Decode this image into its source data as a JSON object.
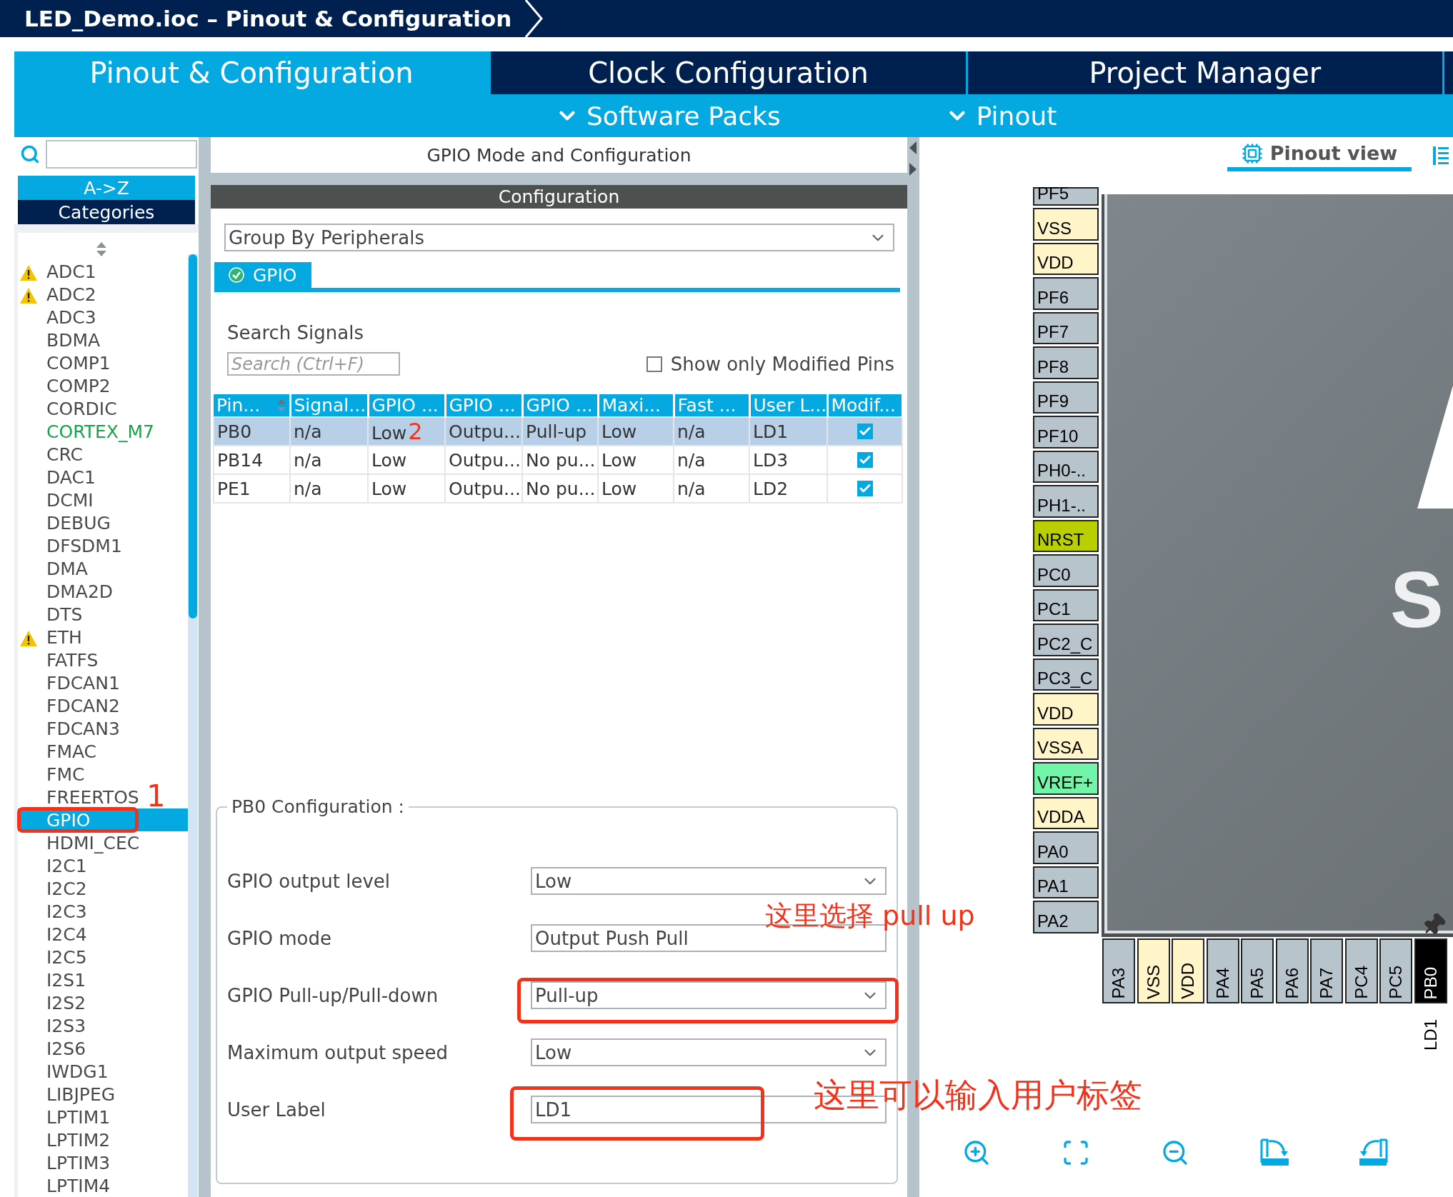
{
  "window": {
    "title": "LED_Demo.ioc – Pinout & Configuration"
  },
  "tabs": [
    {
      "label": "Pinout & Configuration",
      "selected": true
    },
    {
      "label": "Clock Configuration",
      "selected": false
    },
    {
      "label": "Project Manager",
      "selected": false
    }
  ],
  "menus": [
    {
      "label": "Software Packs"
    },
    {
      "label": "Pinout"
    }
  ],
  "sidebar": {
    "sort_modes": [
      {
        "label": "A->Z",
        "selected": true
      },
      {
        "label": "Categories",
        "selected": false
      }
    ],
    "items": [
      {
        "label": "ADC1",
        "warning": true,
        "configured": false,
        "selected": false
      },
      {
        "label": "ADC2",
        "warning": true,
        "configured": false,
        "selected": false
      },
      {
        "label": "ADC3",
        "warning": false,
        "configured": false,
        "selected": false
      },
      {
        "label": "BDMA",
        "warning": false,
        "configured": false,
        "selected": false
      },
      {
        "label": "COMP1",
        "warning": false,
        "configured": false,
        "selected": false
      },
      {
        "label": "COMP2",
        "warning": false,
        "configured": false,
        "selected": false
      },
      {
        "label": "CORDIC",
        "warning": false,
        "configured": false,
        "selected": false
      },
      {
        "label": "CORTEX_M7",
        "warning": false,
        "configured": true,
        "selected": false
      },
      {
        "label": "CRC",
        "warning": false,
        "configured": false,
        "selected": false
      },
      {
        "label": "DAC1",
        "warning": false,
        "configured": false,
        "selected": false
      },
      {
        "label": "DCMI",
        "warning": false,
        "configured": false,
        "selected": false
      },
      {
        "label": "DEBUG",
        "warning": false,
        "configured": false,
        "selected": false
      },
      {
        "label": "DFSDM1",
        "warning": false,
        "configured": false,
        "selected": false
      },
      {
        "label": "DMA",
        "warning": false,
        "configured": false,
        "selected": false
      },
      {
        "label": "DMA2D",
        "warning": false,
        "configured": false,
        "selected": false
      },
      {
        "label": "DTS",
        "warning": false,
        "configured": false,
        "selected": false
      },
      {
        "label": "ETH",
        "warning": true,
        "configured": false,
        "selected": false
      },
      {
        "label": "FATFS",
        "warning": false,
        "configured": false,
        "selected": false
      },
      {
        "label": "FDCAN1",
        "warning": false,
        "configured": false,
        "selected": false
      },
      {
        "label": "FDCAN2",
        "warning": false,
        "configured": false,
        "selected": false
      },
      {
        "label": "FDCAN3",
        "warning": false,
        "configured": false,
        "selected": false
      },
      {
        "label": "FMAC",
        "warning": false,
        "configured": false,
        "selected": false
      },
      {
        "label": "FMC",
        "warning": false,
        "configured": false,
        "selected": false
      },
      {
        "label": "FREERTOS",
        "warning": false,
        "configured": false,
        "selected": false
      },
      {
        "label": "GPIO",
        "warning": false,
        "configured": false,
        "selected": true
      },
      {
        "label": "HDMI_CEC",
        "warning": false,
        "configured": false,
        "selected": false
      },
      {
        "label": "I2C1",
        "warning": false,
        "configured": false,
        "selected": false
      },
      {
        "label": "I2C2",
        "warning": false,
        "configured": false,
        "selected": false
      },
      {
        "label": "I2C3",
        "warning": false,
        "configured": false,
        "selected": false
      },
      {
        "label": "I2C4",
        "warning": false,
        "configured": false,
        "selected": false
      },
      {
        "label": "I2C5",
        "warning": false,
        "configured": false,
        "selected": false
      },
      {
        "label": "I2S1",
        "warning": false,
        "configured": false,
        "selected": false
      },
      {
        "label": "I2S2",
        "warning": false,
        "configured": false,
        "selected": false
      },
      {
        "label": "I2S3",
        "warning": false,
        "configured": false,
        "selected": false
      },
      {
        "label": "I2S6",
        "warning": false,
        "configured": false,
        "selected": false
      },
      {
        "label": "IWDG1",
        "warning": false,
        "configured": false,
        "selected": false
      },
      {
        "label": "LIBJPEG",
        "warning": false,
        "configured": false,
        "selected": false
      },
      {
        "label": "LPTIM1",
        "warning": false,
        "configured": false,
        "selected": false
      },
      {
        "label": "LPTIM2",
        "warning": false,
        "configured": false,
        "selected": false
      },
      {
        "label": "LPTIM3",
        "warning": false,
        "configured": false,
        "selected": false
      },
      {
        "label": "LPTIM4",
        "warning": false,
        "configured": false,
        "selected": false
      }
    ]
  },
  "mode_panel": {
    "title": "GPIO Mode and Configuration",
    "section": "Configuration",
    "group_by": "Group By Peripherals",
    "tabs": [
      {
        "label": "GPIO",
        "selected": true
      }
    ],
    "search_label": "Search Signals",
    "search_placeholder": "Search (Ctrl+F)",
    "show_modified": {
      "label": "Show only Modified Pins",
      "checked": false
    },
    "table": {
      "columns": [
        "Pin...",
        "Signal...",
        "GPIO ...",
        "GPIO ...",
        "GPIO ...",
        "Maxi...",
        "Fast ...",
        "User L...",
        "Modif..."
      ],
      "rows": [
        {
          "selected": true,
          "cells": [
            "PB0",
            "n/a",
            "Low",
            "Outpu...",
            "Pull-up",
            "Low",
            "n/a",
            "LD1"
          ],
          "modified": true
        },
        {
          "selected": false,
          "cells": [
            "PB14",
            "n/a",
            "Low",
            "Outpu...",
            "No pu...",
            "Low",
            "n/a",
            "LD3"
          ],
          "modified": true
        },
        {
          "selected": false,
          "cells": [
            "PE1",
            "n/a",
            "Low",
            "Outpu...",
            "No pu...",
            "Low",
            "n/a",
            "LD2"
          ],
          "modified": true
        }
      ]
    },
    "pin_config": {
      "title": "PB0 Configuration :",
      "fields": [
        {
          "label": "GPIO output level",
          "value": "Low",
          "kind": "select"
        },
        {
          "label": "GPIO mode",
          "value": "Output Push Pull",
          "kind": "static"
        },
        {
          "label": "GPIO Pull-up/Pull-down",
          "value": "Pull-up",
          "kind": "select"
        },
        {
          "label": "Maximum output speed",
          "value": "Low",
          "kind": "select"
        },
        {
          "label": "User Label",
          "value": "LD1",
          "kind": "text"
        }
      ]
    }
  },
  "pinout": {
    "view_tab": {
      "label": "Pinout view",
      "selected": true
    },
    "left_pins": [
      {
        "name": "PF5",
        "color": "#b8c4cc"
      },
      {
        "name": "VSS",
        "color": "#fff5c8"
      },
      {
        "name": "VDD",
        "color": "#fff5c8"
      },
      {
        "name": "PF6",
        "color": "#b8c4cc"
      },
      {
        "name": "PF7",
        "color": "#b8c4cc"
      },
      {
        "name": "PF8",
        "color": "#b8c4cc"
      },
      {
        "name": "PF9",
        "color": "#b8c4cc"
      },
      {
        "name": "PF10",
        "color": "#b8c4cc"
      },
      {
        "name": "PH0-..",
        "color": "#b8c4cc"
      },
      {
        "name": "PH1-..",
        "color": "#b8c4cc"
      },
      {
        "name": "NRST",
        "color": "#b9cf00"
      },
      {
        "name": "PC0",
        "color": "#b8c4cc"
      },
      {
        "name": "PC1",
        "color": "#b8c4cc"
      },
      {
        "name": "PC2_C",
        "color": "#b8c4cc"
      },
      {
        "name": "PC3_C",
        "color": "#b8c4cc"
      },
      {
        "name": "VDD",
        "color": "#fff5c8"
      },
      {
        "name": "VSSA",
        "color": "#fff5c8"
      },
      {
        "name": "VREF+",
        "color": "#72f5a8"
      },
      {
        "name": "VDDA",
        "color": "#fff5c8"
      },
      {
        "name": "PA0",
        "color": "#b8c4cc"
      },
      {
        "name": "PA1",
        "color": "#b8c4cc"
      },
      {
        "name": "PA2",
        "color": "#b8c4cc"
      }
    ],
    "bottom_pins": [
      {
        "name": "PA3",
        "color": "#b8c4cc"
      },
      {
        "name": "VSS",
        "color": "#fff5c8"
      },
      {
        "name": "VDD",
        "color": "#fff5c8"
      },
      {
        "name": "PA4",
        "color": "#b8c4cc"
      },
      {
        "name": "PA5",
        "color": "#b8c4cc"
      },
      {
        "name": "PA6",
        "color": "#b8c4cc"
      },
      {
        "name": "PA7",
        "color": "#b8c4cc"
      },
      {
        "name": "PC4",
        "color": "#b8c4cc"
      },
      {
        "name": "PC5",
        "color": "#b8c4cc"
      },
      {
        "name": "PB0",
        "color": "#000000",
        "label": "LD1",
        "pinned": true
      }
    ],
    "chip_marking": "S"
  },
  "annotations": [
    {
      "kind": "box"
    },
    {
      "kind": "text",
      "text": "1"
    },
    {
      "kind": "text",
      "text": "2"
    },
    {
      "kind": "text",
      "text": "这里选择 pull up"
    },
    {
      "kind": "box"
    },
    {
      "kind": "text",
      "text": "这里可以输入用户标签"
    },
    {
      "kind": "box"
    }
  ]
}
